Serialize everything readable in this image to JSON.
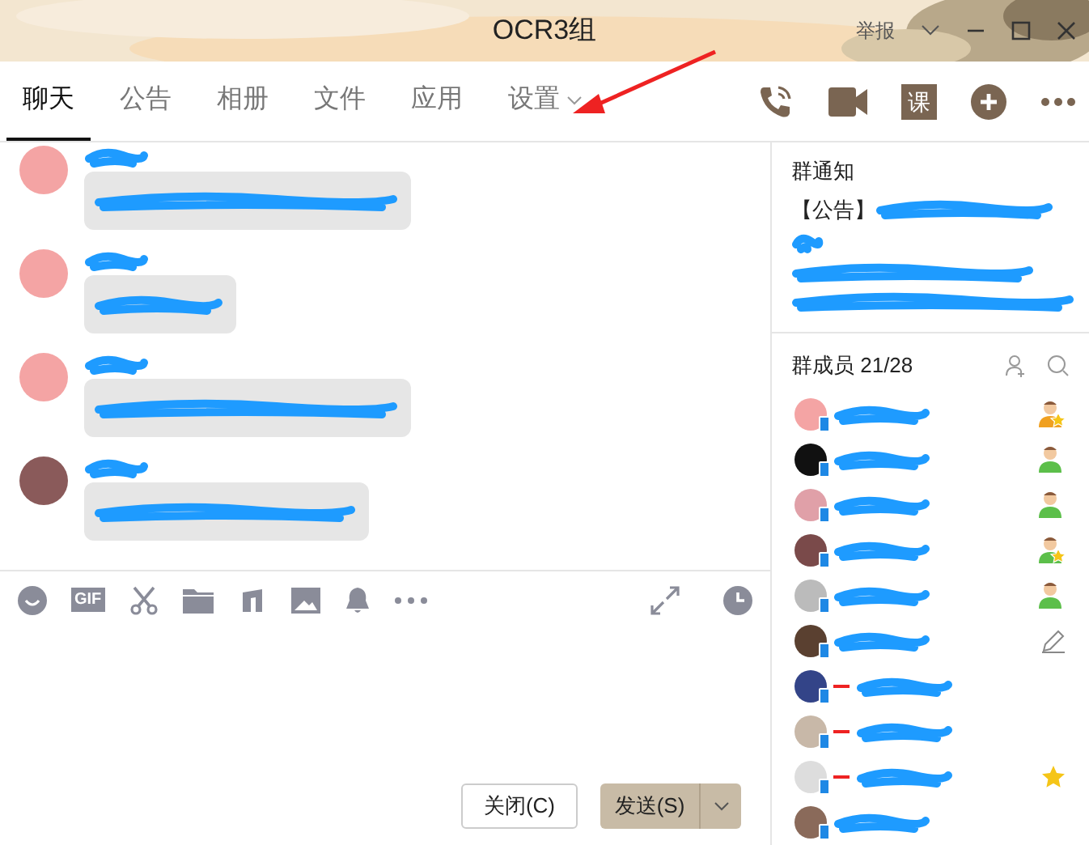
{
  "window": {
    "title": "OCR3组",
    "report": "举报"
  },
  "tabs": [
    {
      "label": "聊天",
      "selected": true
    },
    {
      "label": "公告",
      "selected": false
    },
    {
      "label": "相册",
      "selected": false
    },
    {
      "label": "文件",
      "selected": false
    },
    {
      "label": "应用",
      "selected": false
    },
    {
      "label": "设置",
      "selected": false,
      "dropdown": true
    }
  ],
  "course_button": "课",
  "toolbar": {
    "gif": "GIF"
  },
  "buttons": {
    "close": "关闭(C)",
    "send": "发送(S)"
  },
  "notice": {
    "title": "群通知",
    "tag": "【公告】"
  },
  "members_header": "群成员 21/28",
  "members": [
    {
      "kind": "owner",
      "highlighted": false
    },
    {
      "kind": "member",
      "highlighted": false
    },
    {
      "kind": "member",
      "highlighted": false
    },
    {
      "kind": "admin",
      "highlighted": false
    },
    {
      "kind": "member",
      "highlighted": false
    },
    {
      "kind": "editor",
      "highlighted": false
    },
    {
      "kind": "plain",
      "highlighted": true
    },
    {
      "kind": "plain",
      "highlighted": true
    },
    {
      "kind": "starred",
      "highlighted": true
    },
    {
      "kind": "plain",
      "highlighted": false
    }
  ]
}
